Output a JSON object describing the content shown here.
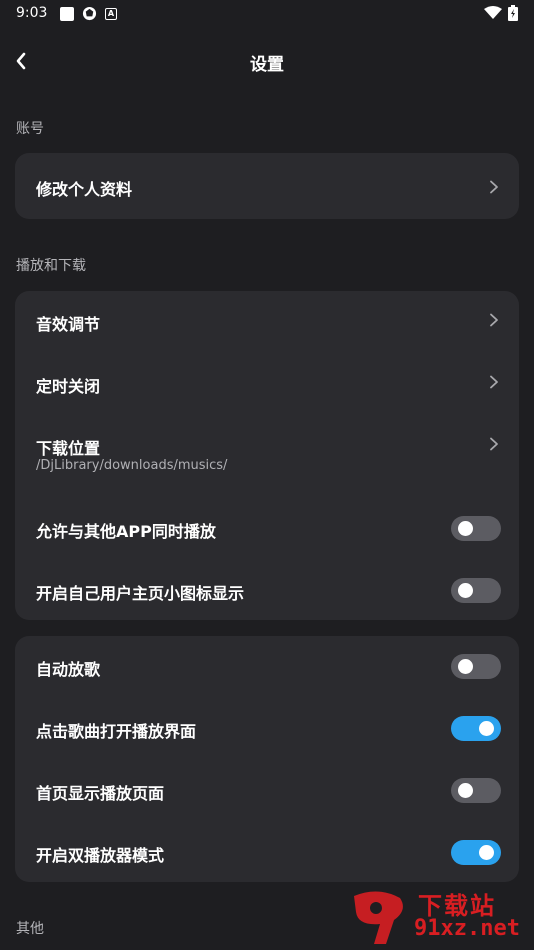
{
  "status": {
    "time": "9:03"
  },
  "header": {
    "title": "设置"
  },
  "sections": {
    "account": {
      "label": "账号",
      "items": [
        {
          "label": "修改个人资料"
        }
      ]
    },
    "playback": {
      "label": "播放和下载",
      "items": [
        {
          "label": "音效调节"
        },
        {
          "label": "定时关闭"
        },
        {
          "label": "下载位置",
          "sub": "/DjLibrary/downloads/musics/"
        },
        {
          "label": "允许与其他APP同时播放",
          "toggle": false
        },
        {
          "label": "开启自己用户主页小图标显示",
          "toggle": false
        }
      ]
    },
    "player": {
      "items": [
        {
          "label": "自动放歌",
          "toggle": false
        },
        {
          "label": "点击歌曲打开播放界面",
          "toggle": true
        },
        {
          "label": "首页显示播放页面",
          "toggle": false
        },
        {
          "label": "开启双播放器模式",
          "toggle": true
        }
      ]
    },
    "other": {
      "label": "其他"
    }
  },
  "watermark": {
    "top": "下载站",
    "bottom": "91xz.net"
  },
  "colors": {
    "toggle_on": "#2aa2ee",
    "toggle_off": "#5c5c62",
    "card": "#2b2b2f",
    "background": "#1e1e21"
  }
}
